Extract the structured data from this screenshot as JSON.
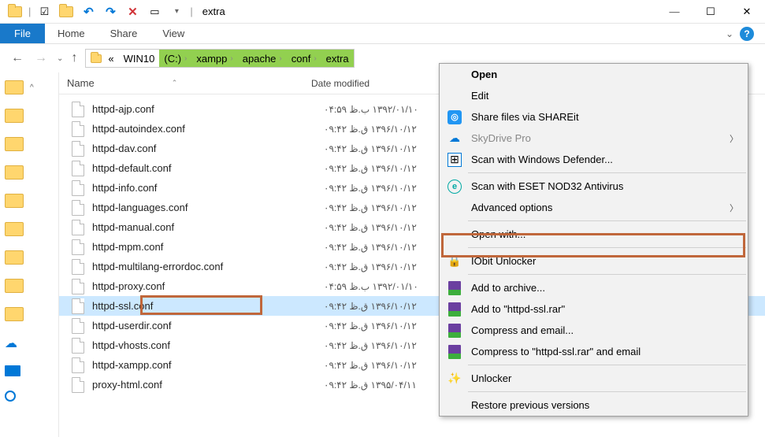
{
  "window": {
    "title": "extra",
    "minimize": "—",
    "maximize": "☐",
    "close": "✕"
  },
  "ribbon": {
    "file": "File",
    "tabs": [
      "Home",
      "Share",
      "View"
    ]
  },
  "addressbar": {
    "prefix": "«",
    "root": "WIN10",
    "segments": [
      "(C:)",
      "xampp",
      "apache",
      "conf",
      "extra"
    ]
  },
  "columns": {
    "name": "Name",
    "date": "Date modified"
  },
  "files": [
    {
      "name": "httpd-ajp.conf",
      "date": "۱۳۹۲/۰۱/۱۰ ب.ظ ۰۴:۵۹",
      "selected": false
    },
    {
      "name": "httpd-autoindex.conf",
      "date": "۱۳۹۶/۱۰/۱۲ ق.ظ ۰۹:۴۲",
      "selected": false
    },
    {
      "name": "httpd-dav.conf",
      "date": "۱۳۹۶/۱۰/۱۲ ق.ظ ۰۹:۴۲",
      "selected": false
    },
    {
      "name": "httpd-default.conf",
      "date": "۱۳۹۶/۱۰/۱۲ ق.ظ ۰۹:۴۲",
      "selected": false
    },
    {
      "name": "httpd-info.conf",
      "date": "۱۳۹۶/۱۰/۱۲ ق.ظ ۰۹:۴۲",
      "selected": false
    },
    {
      "name": "httpd-languages.conf",
      "date": "۱۳۹۶/۱۰/۱۲ ق.ظ ۰۹:۴۲",
      "selected": false
    },
    {
      "name": "httpd-manual.conf",
      "date": "۱۳۹۶/۱۰/۱۲ ق.ظ ۰۹:۴۲",
      "selected": false
    },
    {
      "name": "httpd-mpm.conf",
      "date": "۱۳۹۶/۱۰/۱۲ ق.ظ ۰۹:۴۲",
      "selected": false
    },
    {
      "name": "httpd-multilang-errordoc.conf",
      "date": "۱۳۹۶/۱۰/۱۲ ق.ظ ۰۹:۴۲",
      "selected": false
    },
    {
      "name": "httpd-proxy.conf",
      "date": "۱۳۹۲/۰۱/۱۰ ب.ظ ۰۴:۵۹",
      "selected": false
    },
    {
      "name": "httpd-ssl.conf",
      "date": "۱۳۹۶/۱۰/۱۲ ق.ظ ۰۹:۴۲",
      "selected": true
    },
    {
      "name": "httpd-userdir.conf",
      "date": "۱۳۹۶/۱۰/۱۲ ق.ظ ۰۹:۴۲",
      "selected": false
    },
    {
      "name": "httpd-vhosts.conf",
      "date": "۱۳۹۶/۱۰/۱۲ ق.ظ ۰۹:۴۲",
      "selected": false
    },
    {
      "name": "httpd-xampp.conf",
      "date": "۱۳۹۶/۱۰/۱۲ ق.ظ ۰۹:۴۲",
      "selected": false
    },
    {
      "name": "proxy-html.conf",
      "date": "۱۳۹۵/۰۴/۱۱ ق.ظ ۰۹:۴۲",
      "selected": false
    }
  ],
  "contextmenu": {
    "open": "Open",
    "edit": "Edit",
    "shareit": "Share files via SHAREit",
    "skydrive": "SkyDrive Pro",
    "defender": "Scan with Windows Defender...",
    "eset": "Scan with ESET NOD32 Antivirus",
    "advopts": "Advanced options",
    "openwith": "Open with...",
    "iobit": "IObit Unlocker",
    "addarchive": "Add to archive...",
    "addrar": "Add to \"httpd-ssl.rar\"",
    "compressmail": "Compress and email...",
    "compressrar": "Compress to \"httpd-ssl.rar\" and email",
    "unlocker": "Unlocker",
    "restore": "Restore previous versions"
  }
}
